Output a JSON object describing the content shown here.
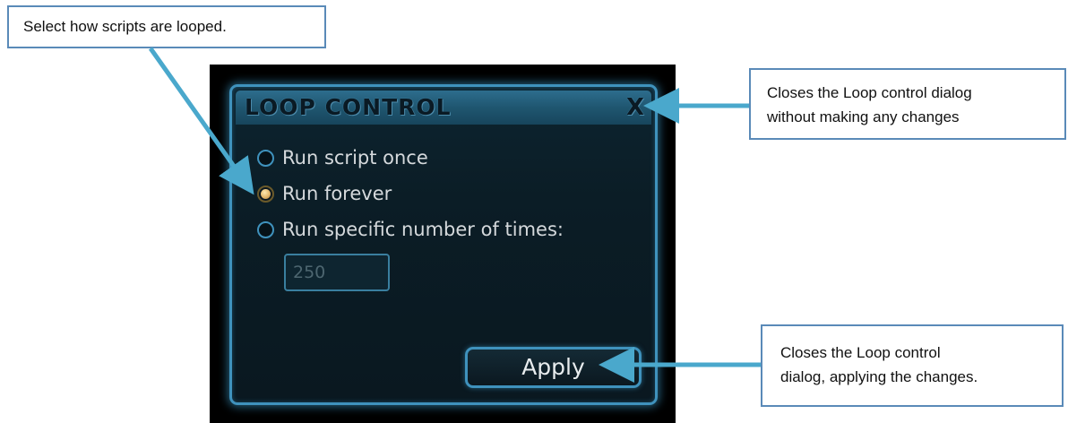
{
  "callouts": {
    "loop": "Select how scripts are looped.",
    "close_line1": "Closes the Loop control dialog",
    "close_line2": "without making any changes",
    "apply_line1": "Closes the Loop control",
    "apply_line2": "dialog, applying the changes."
  },
  "dialog": {
    "title": "LOOP CONTROL",
    "close_label": "X",
    "options": [
      {
        "label": "Run script once",
        "checked": false
      },
      {
        "label": "Run forever",
        "checked": true
      },
      {
        "label": "Run specific number of times:",
        "checked": false
      }
    ],
    "times_value": "250",
    "apply_label": "Apply"
  },
  "colors": {
    "accent": "#3f92bd",
    "callout_arrow": "#4aa8cc",
    "radio_selected": "#e2b66b",
    "background": "#0b1d26"
  },
  "icons": {
    "close": "close-icon",
    "radio": "radio-button-icon"
  }
}
